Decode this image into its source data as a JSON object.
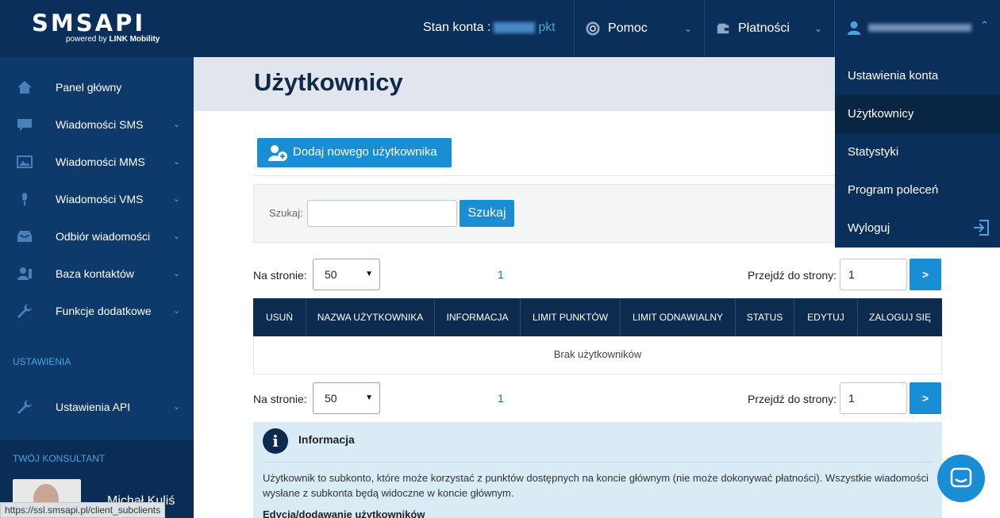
{
  "logo": {
    "main": "SMSAPI",
    "powered": "powered by",
    "brand": "LINK Mobility"
  },
  "header": {
    "balance_label": "Stan konta :",
    "balance_unit": "pkt",
    "help_label": "Pomoc",
    "payments_label": "Płatności"
  },
  "sidebar": {
    "items": [
      {
        "label": "Panel główny",
        "icon": "home-icon"
      },
      {
        "label": "Wiadomości SMS",
        "icon": "chat-icon"
      },
      {
        "label": "Wiadomości MMS",
        "icon": "image-icon"
      },
      {
        "label": "Wiadomości VMS",
        "icon": "microphone-icon"
      },
      {
        "label": "Odbiór wiadomości",
        "icon": "inbox-icon"
      },
      {
        "label": "Baza kontaktów",
        "icon": "contacts-icon"
      },
      {
        "label": "Funkcje dodatkowe",
        "icon": "wrench-icon"
      }
    ],
    "settings_section": "USTAWIENIA",
    "settings_items": [
      {
        "label": "Ustawienia API",
        "icon": "wrench-icon"
      }
    ],
    "consultant_title": "TWÓJ KONSULTANT",
    "consultant_name": "Michał Kuliś"
  },
  "statusbar": {
    "url": "https://ssl.smsapi.pl/client_subclients"
  },
  "main": {
    "title": "Użytkownicy",
    "add_button": "Dodaj nowego użytkownika",
    "search": {
      "label": "Szukaj:",
      "button": "Szukaj",
      "value": ""
    },
    "pagination": {
      "per_page_label": "Na stronie:",
      "per_page_value": "50",
      "current_page": "1",
      "goto_label": "Przejdź do strony:",
      "goto_value": "1",
      "go_button": ">"
    },
    "table": {
      "columns": [
        "USUŃ",
        "NAZWA UŻYTKOWNIKA",
        "INFORMACJA",
        "LIMIT PUNKTÓW",
        "LIMIT ODNAWIALNY",
        "STATUS",
        "EDYTUJ",
        "ZALOGUJ SIĘ"
      ],
      "empty_text": "Brak użytkowników"
    },
    "info": {
      "icon": "i",
      "title": "Informacja",
      "text": "Użytkownik to subkonto, które może korzystać z punktów dostępnych na koncie głównym (nie może dokonywać płatności). Wszystkie wiadomości wysłane z subkonta będą widoczne w koncie głównym.",
      "subtitle": "Edycja/dodawanie użytkowników"
    }
  },
  "dropdown": {
    "items": [
      "Ustawienia konta",
      "Użytkownicy",
      "Statystyki",
      "Program poleceń",
      "Wyloguj"
    ],
    "active_index": 1
  },
  "colors": {
    "primary": "#1a8ed4",
    "nav_bg": "#0b2f5b",
    "sidebar_bg": "#0d3a6b",
    "table_head": "#0d2b4e"
  }
}
